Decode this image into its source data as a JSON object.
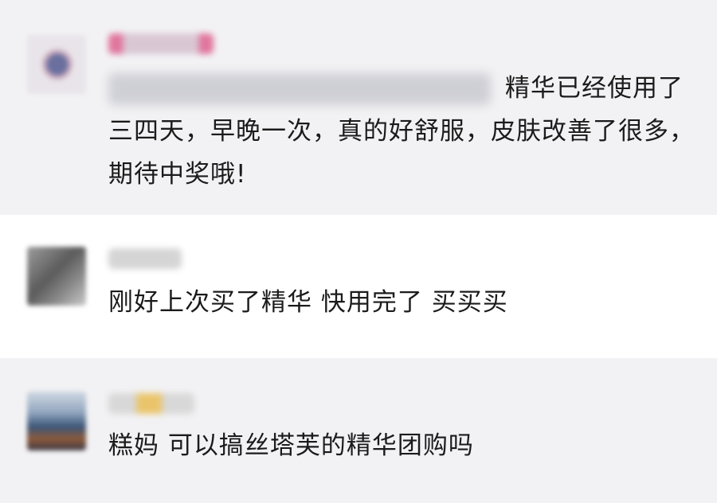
{
  "comments": [
    {
      "text": "精华已经使用了三四天，早晚一次，真的好舒服，皮肤改善了很多，期待中奖哦!"
    },
    {
      "text": "刚好上次买了精华 快用完了 买买买"
    },
    {
      "text": "糕妈 可以搞丝塔芙的精华团购吗"
    }
  ]
}
